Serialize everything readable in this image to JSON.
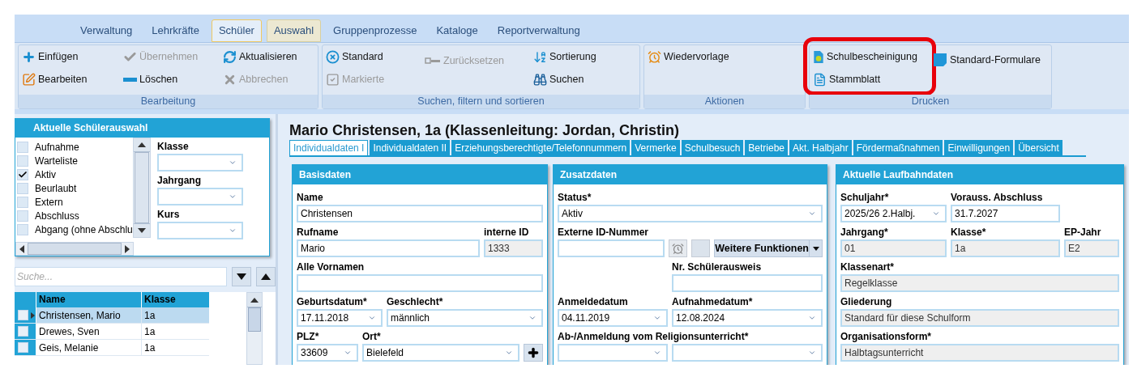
{
  "ribbon": {
    "tabs": [
      {
        "label": "Verwaltung",
        "selected": false,
        "kind": "normal"
      },
      {
        "label": "Lehrkräfte",
        "selected": false,
        "kind": "normal"
      },
      {
        "label": "Schüler",
        "selected": true,
        "kind": "normal"
      },
      {
        "label": "Auswahl",
        "selected": false,
        "kind": "contextual"
      },
      {
        "label": "Gruppenprozesse",
        "selected": false,
        "kind": "normal"
      },
      {
        "label": "Kataloge",
        "selected": false,
        "kind": "normal"
      },
      {
        "label": "Reportverwaltung",
        "selected": false,
        "kind": "normal"
      }
    ],
    "groups": [
      {
        "label": "Bearbeitung",
        "columns": [
          {
            "highlighted": false,
            "items": [
              {
                "label": "Einfügen",
                "disabled": false
              },
              {
                "label": "Bearbeiten",
                "disabled": false
              }
            ]
          },
          {
            "highlighted": false,
            "items": [
              {
                "label": "Übernehmen",
                "disabled": true
              },
              {
                "label": "Löschen",
                "disabled": false
              }
            ]
          },
          {
            "highlighted": false,
            "items": [
              {
                "label": "Aktualisieren",
                "disabled": false
              },
              {
                "label": "Abbrechen",
                "disabled": true
              }
            ]
          }
        ]
      },
      {
        "label": "Suchen, filtern und sortieren",
        "columns": [
          {
            "highlighted": false,
            "items": [
              {
                "label": "Standard",
                "disabled": false
              },
              {
                "label": "Markierte",
                "disabled": true
              }
            ]
          },
          {
            "highlighted": false,
            "items": [
              {
                "label": "Zurücksetzen",
                "disabled": true
              }
            ]
          },
          {
            "highlighted": false,
            "items": [
              {
                "label": "Sortierung",
                "disabled": false
              },
              {
                "label": "Suchen",
                "disabled": false
              }
            ]
          }
        ]
      },
      {
        "label": "Aktionen",
        "columns": [
          {
            "highlighted": false,
            "items": [
              {
                "label": "Wiedervorlage",
                "disabled": false
              }
            ]
          }
        ]
      },
      {
        "label": "Drucken",
        "columns": [
          {
            "highlighted": true,
            "items": [
              {
                "label": "Schulbescheinigung",
                "disabled": false
              },
              {
                "label": "Stammblatt",
                "disabled": false
              }
            ]
          },
          {
            "highlighted": false,
            "items": [
              {
                "label": "Standard-Formulare",
                "disabled": false
              }
            ]
          }
        ]
      }
    ]
  },
  "selection": {
    "title": "Aktuelle Schülerauswahl",
    "statuses": [
      {
        "label": "Aufnahme",
        "checked": false
      },
      {
        "label": "Warteliste",
        "checked": false
      },
      {
        "label": "Aktiv",
        "checked": true
      },
      {
        "label": "Beurlaubt",
        "checked": false
      },
      {
        "label": "Extern",
        "checked": false
      },
      {
        "label": "Abschluss",
        "checked": false
      },
      {
        "label": "Abgang (ohne Abschlu",
        "checked": false
      }
    ],
    "filters": [
      {
        "label": "Klasse"
      },
      {
        "label": "Jahrgang"
      },
      {
        "label": "Kurs"
      }
    ]
  },
  "search": {
    "placeholder": "Suche..."
  },
  "student_grid": {
    "columns": [
      "Name",
      "Klasse"
    ],
    "rows": [
      {
        "name": "Christensen, Mario",
        "klasse": "1a",
        "selected": true
      },
      {
        "name": "Drewes, Sven",
        "klasse": "1a",
        "selected": false
      },
      {
        "name": "Geis, Melanie",
        "klasse": "1a",
        "selected": false
      }
    ]
  },
  "student": {
    "title": "Mario Christensen, 1a (Klassenleitung: Jordan, Christin)",
    "tabs": [
      {
        "label": "Individualdaten I",
        "selected": true
      },
      {
        "label": "Individualdaten II",
        "selected": false
      },
      {
        "label": "Erziehungsberechtigte/Telefonnummern",
        "selected": false
      },
      {
        "label": "Vermerke",
        "selected": false
      },
      {
        "label": "Schulbesuch",
        "selected": false
      },
      {
        "label": "Betriebe",
        "selected": false
      },
      {
        "label": "Akt. Halbjahr",
        "selected": false
      },
      {
        "label": "Fördermaßnahmen",
        "selected": false
      },
      {
        "label": "Einwilligungen",
        "selected": false
      },
      {
        "label": "Übersicht",
        "selected": false
      }
    ],
    "panels": [
      {
        "title": "Basisdaten",
        "rows": [
          [
            {
              "kind": "text",
              "label": "Name",
              "value": "Christensen"
            }
          ],
          [
            {
              "kind": "text",
              "label": "Rufname",
              "value": "Mario"
            },
            {
              "kind": "readonly",
              "label": "interne ID",
              "value": "1333"
            }
          ],
          [
            {
              "kind": "text",
              "label": "Alle Vornamen"
            }
          ],
          [
            {
              "kind": "combo",
              "label": "Geburtsdatum*",
              "value": "17.11.2018"
            },
            {
              "kind": "combo",
              "label": "Geschlecht*",
              "value": "männlich"
            }
          ],
          [
            {
              "kind": "combo",
              "label": "PLZ*",
              "value": "33609"
            },
            {
              "kind": "combo",
              "label": "Ort*",
              "value": "Bielefeld"
            },
            {
              "kind": "add-button"
            }
          ]
        ]
      },
      {
        "title": "Zusatzdaten",
        "rows": [
          [
            {
              "kind": "combo",
              "label": "Status*",
              "value": "Aktiv"
            }
          ],
          [
            {
              "kind": "text",
              "label": "Externe ID-Nummer"
            },
            {
              "kind": "alarm-button"
            },
            {
              "kind": "blank-button"
            },
            {
              "kind": "split-button",
              "value": "Weitere Funktionen"
            }
          ],
          [
            {
              "kind": "text",
              "label": "Nr. Schülerausweis"
            }
          ],
          [
            {
              "kind": "combo",
              "label": "Anmeldedatum",
              "value": "04.11.2019"
            },
            {
              "kind": "combo",
              "label": "Aufnahmedatum*",
              "value": "12.08.2024"
            }
          ],
          [
            {
              "kind": "combo",
              "label": "Ab-/Anmeldung vom Religionsunterricht*"
            },
            {
              "kind": "combo"
            }
          ]
        ]
      },
      {
        "title": "Aktuelle Laufbahndaten",
        "rows": [
          [
            {
              "kind": "combo",
              "label": "Schuljahr*",
              "value": "2025/26 2.Halbj."
            },
            {
              "kind": "text",
              "label": "Vorauss. Abschluss",
              "value": "31.7.2027"
            }
          ],
          [
            {
              "kind": "readonly",
              "label": "Jahrgang*",
              "value": "01"
            },
            {
              "kind": "readonly",
              "label": "Klasse*",
              "value": "1a"
            },
            {
              "kind": "readonly",
              "label": "EP-Jahr",
              "value": "E2"
            }
          ],
          [
            {
              "kind": "readonly",
              "label": "Klassenart*",
              "value": "Regelklasse"
            }
          ],
          [
            {
              "kind": "readonly",
              "label": "Gliederung",
              "value": "Standard für diese Schulform"
            }
          ],
          [
            {
              "kind": "readonly",
              "label": "Organisationsform*",
              "value": "Halbtagsunterricht"
            }
          ]
        ]
      }
    ]
  }
}
